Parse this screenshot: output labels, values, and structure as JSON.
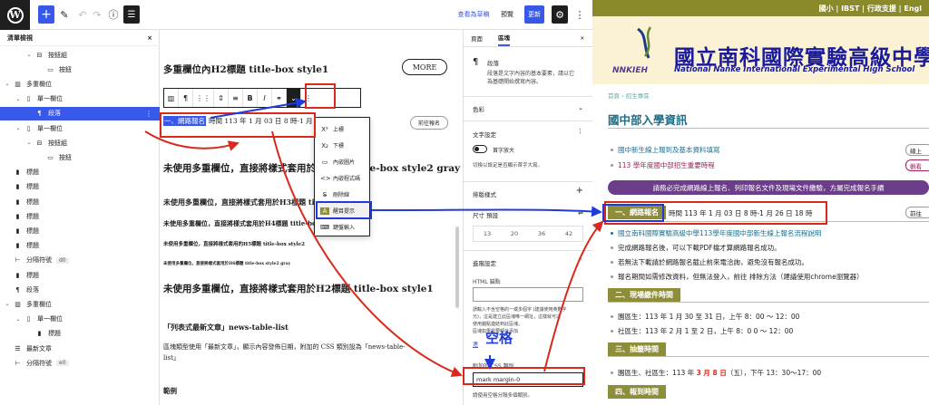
{
  "topbar": {
    "preview_draft": "查看為草稿",
    "preview": "預覽",
    "update": "更新"
  },
  "list_view": {
    "title": "清單檢視",
    "close": "×",
    "items": [
      {
        "label": "按鈕組",
        "icon": "buttons-icon"
      },
      {
        "label": "按鈕",
        "icon": "button-icon"
      },
      {
        "label": "多重欄位",
        "icon": "columns-icon"
      },
      {
        "label": "單一欄位",
        "icon": "column-icon"
      },
      {
        "label": "段落",
        "icon": "paragraph-icon"
      },
      {
        "label": "單一欄位",
        "icon": "column-icon"
      },
      {
        "label": "按鈕組",
        "icon": "buttons-icon"
      },
      {
        "label": "按鈕",
        "icon": "button-icon"
      },
      {
        "label": "標題",
        "icon": "heading-icon"
      },
      {
        "label": "標題",
        "icon": "heading-icon"
      },
      {
        "label": "標題",
        "icon": "heading-icon"
      },
      {
        "label": "標題",
        "icon": "heading-icon"
      },
      {
        "label": "標題",
        "icon": "heading-icon"
      },
      {
        "label": "標題",
        "icon": "heading-icon"
      },
      {
        "label": "分隔符號",
        "icon": "separator-icon",
        "badge": "d0"
      },
      {
        "label": "標題",
        "icon": "heading-icon"
      },
      {
        "label": "段落",
        "icon": "paragraph-icon"
      },
      {
        "label": "多重欄位",
        "icon": "columns-icon"
      },
      {
        "label": "單一欄位",
        "icon": "column-icon"
      },
      {
        "label": "標題",
        "icon": "heading-icon"
      },
      {
        "label": "最新文章",
        "icon": "latest-posts-icon"
      },
      {
        "label": "分隔符號",
        "icon": "separator-icon",
        "badge": "e0"
      }
    ]
  },
  "canvas": {
    "h2_title": "多重欄位內H2標題 title-box style1",
    "more_button": "MORE",
    "para_highlight": "一、網路報名",
    "para_rest": "時間 113 年 1 月 03 日 8 時-1 月 2",
    "signup_button": "前往報名",
    "h2_gray": "未使用多重欄位，直接將樣式套用於H2標題 title-box style2 gray",
    "h3": "未使用多重欄位，直接將樣式套用於H3標題 title-box style2",
    "h4": "未使用多重欄位，直接將樣式套用於H4標題 title-box style2",
    "h5": "未使用多重欄位，直接將樣式套用的H5標題 title-box style2",
    "h6": "未使用多重欄位，直接將樣式套用於H6標題 title-box style2 gray",
    "h2_style1": "未使用多重欄位，直接將樣式套用於H2標題 title-box style1",
    "list_heading": "「列表式最新文章」news-table-list",
    "list_desc1": "區塊類型使用「最新文章」，顯示內容發佈日期，附加的 CSS 類別設為「news-table-",
    "list_desc2": "list」",
    "example": "範例"
  },
  "format_menu": {
    "items": [
      {
        "label": "上標",
        "icon": "X²"
      },
      {
        "label": "下標",
        "icon": "X₂"
      },
      {
        "label": "內嵌圖片",
        "icon": "▭"
      },
      {
        "label": "內嵌程式碼",
        "icon": "<>"
      },
      {
        "label": "刪除線",
        "icon": "S̶"
      },
      {
        "label": "醒目提示",
        "icon": "A"
      },
      {
        "label": "鍵盤輸入",
        "icon": "⌨"
      }
    ]
  },
  "settings": {
    "tab_page": "頁面",
    "tab_block": "區塊",
    "block_name": "段落",
    "block_desc1": "段落是文字內容的基本要素，請以它",
    "block_desc2": "為基礎開始撰寫內容。",
    "color": "色彩",
    "typography": "文字設定",
    "dropcap": "首字放大",
    "dropcap_help": "切換以設定是否顯示首字大寫。",
    "layout": "排版樣式",
    "size_label": "尺寸 預設",
    "sizes": [
      "13",
      "20",
      "36",
      "42"
    ],
    "advanced": "進階設定",
    "html_anchor": "HTML 錨點",
    "anchor_help1": "請輸入不含空格的一或多個字 (建議使用英數字",
    "anchor_help2": "元)，這是建立此區塊唯一網址，這樣就可以",
    "anchor_help3": "使用錨點連結到此區塊。",
    "anchor_help4": "區塊如果需要額外添加",
    "more_link": "連",
    "css_label": "附加的 CSS 類別",
    "css_value": "mark margin-0",
    "css_help": "請使用空格分隔多個類別。"
  },
  "annotation": {
    "space_label": "空格"
  },
  "site": {
    "top_links": "國小 | IBST | 行政支援 | Engl",
    "school_name": "國立南科國際實驗高級中學",
    "school_en": "National Nanke International Experimental High School",
    "abbr": "NNKIEH",
    "breadcrumb": "首頁 › 招生專區",
    "page_title": "國中部入學資訊",
    "links": [
      {
        "text": "國中新生線上報到及基本資料填寫",
        "button": "線上"
      },
      {
        "text": "113 學年度國中部招生重要時程",
        "button": "觀看"
      }
    ],
    "notice": "請務必完成網路線上報名、列印報名文件及現場文件繳驗，方屬完成報名手續",
    "sec1_label": "一、網路報名",
    "sec1_time": "時間 113 年 1 月 03 日 8 時-1 月 26 日 18 時",
    "sec1_button": "前往",
    "sec1_link": "國立南科國際實驗高級中學113學年度國中部新生線上報名流程說明",
    "sec1_items": [
      "完成網路報名後，可以下載PDF檔才算網路報名成功。",
      "若無法下載請於網路報名截止前來電洽詢，避免沒有報名成功。",
      "報名期間如需修改資料，但無法登入，前往 排除方法（建議使用chrome瀏覽器）"
    ],
    "sec2_label": "二、現場繳件時間",
    "sec2_items": [
      "園區生：113 年 1 月 30 至 31 日，上午 8：00 ～ 12：00",
      "社區生：113 年 2 月 1 至 2 日，上午 8：0 0 ～ 12：00"
    ],
    "sec3_label": "三、抽籤時間",
    "sec3_item_pre": "園區生、社區生：113 年 ",
    "sec3_item_date": "3 月 8 日",
    "sec3_item_post": "（五），下午 13：30～17：00",
    "sec4_label": "四、報到時間"
  },
  "colors": {
    "wp_blue": "#3858e9",
    "annotation_red": "#d9291c",
    "annotation_blue": "#1f3bd8",
    "site_olive": "#8e8e3a",
    "site_purple": "#6b3d8a",
    "school_navy": "#1a1a9a"
  }
}
